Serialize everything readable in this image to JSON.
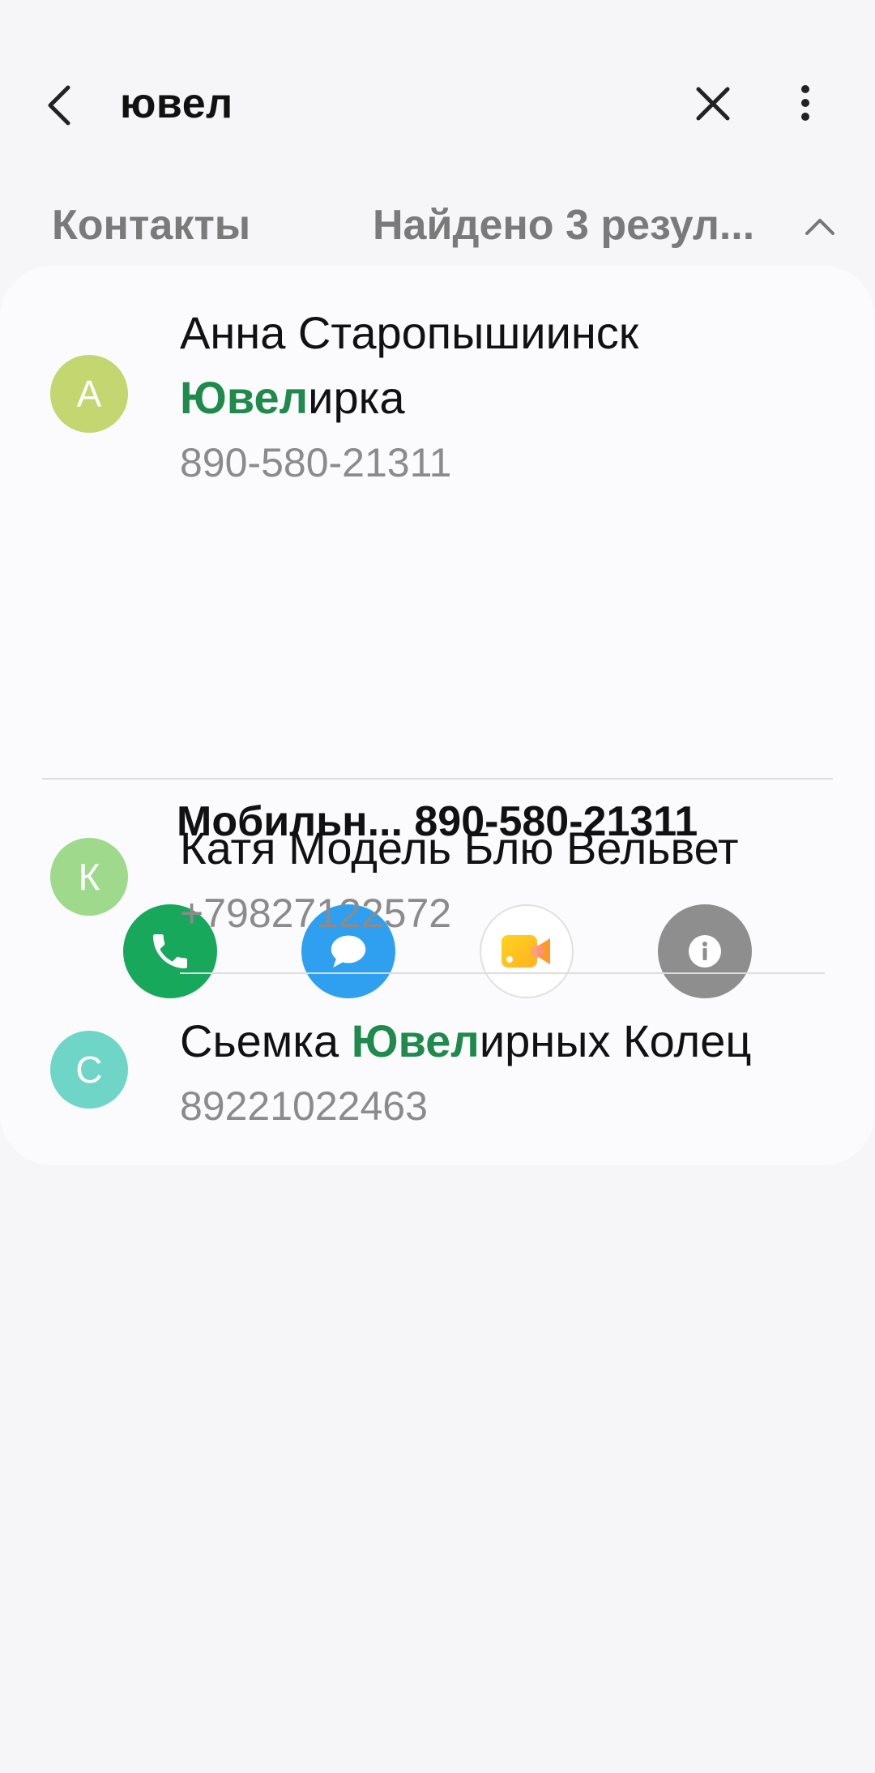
{
  "search": {
    "query": "ювел"
  },
  "header": {
    "section": "Контакты",
    "results": "Найдено 3 резул..."
  },
  "contacts": [
    {
      "initial": "А",
      "avatar_color": "#c3d66f",
      "name_line1": "Анна Старопышиинск",
      "name_hl": "Ювел",
      "name_rest": "ирка",
      "phone": "890-580-21311",
      "detail_label": "Мобильн...",
      "detail_number": "890-580-21311"
    },
    {
      "initial": "К",
      "avatar_color": "#9fd98c",
      "name": "Катя Модель Блю Вельвет",
      "phone": "+79827122572"
    },
    {
      "initial": "С",
      "avatar_color": "#6fd6c7",
      "name_pre": "Сьемка ",
      "name_hl": "Ювел",
      "name_rest": "ирных Колец",
      "phone": "89221022463"
    }
  ],
  "actions": {
    "call_color": "#17a85c",
    "message_color": "#2f9ff0",
    "video_color": "#ffffff",
    "info_color": "#8e8e8e"
  },
  "colors": {
    "highlight": "#1f8a4c",
    "background": "#f6f6f8",
    "card": "#fbfbfd"
  }
}
